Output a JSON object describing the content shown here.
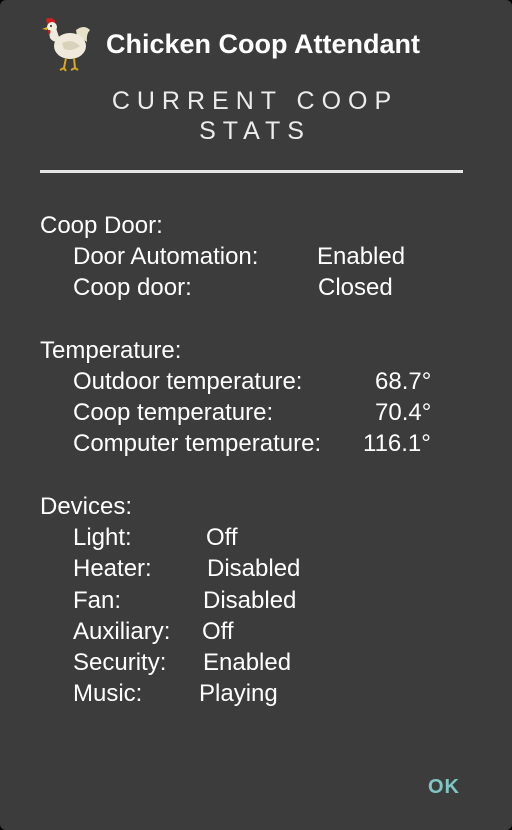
{
  "app": {
    "title": "Chicken Coop Attendant",
    "icon": "chicken-icon"
  },
  "stats": {
    "heading_line1": "CURRENT COOP",
    "heading_line2": "STATS"
  },
  "coop_door": {
    "label": "Coop Door:",
    "rows": [
      {
        "label": "Door Automation:",
        "value": "Enabled"
      },
      {
        "label": "Coop door:",
        "value": "Closed"
      }
    ]
  },
  "temperature": {
    "label": "Temperature:",
    "rows": [
      {
        "label": "Outdoor temperature:",
        "value": "68.7°"
      },
      {
        "label": "Coop temperature:",
        "value": "70.4°"
      },
      {
        "label": "Computer temperature:",
        "value": "116.1°"
      }
    ]
  },
  "devices": {
    "label": "Devices:",
    "rows": [
      {
        "label": "Light:",
        "value": "Off"
      },
      {
        "label": "Heater:",
        "value": "Disabled"
      },
      {
        "label": "Fan:",
        "value": "Disabled"
      },
      {
        "label": "Auxiliary:",
        "value": "Off"
      },
      {
        "label": "Security:",
        "value": "Enabled"
      },
      {
        "label": "Music:",
        "value": "Playing"
      }
    ]
  },
  "actions": {
    "ok_label": "OK"
  },
  "colors": {
    "dialog_background": "#3c3c3c",
    "text": "#ffffff",
    "accent": "#7fc6c3"
  }
}
